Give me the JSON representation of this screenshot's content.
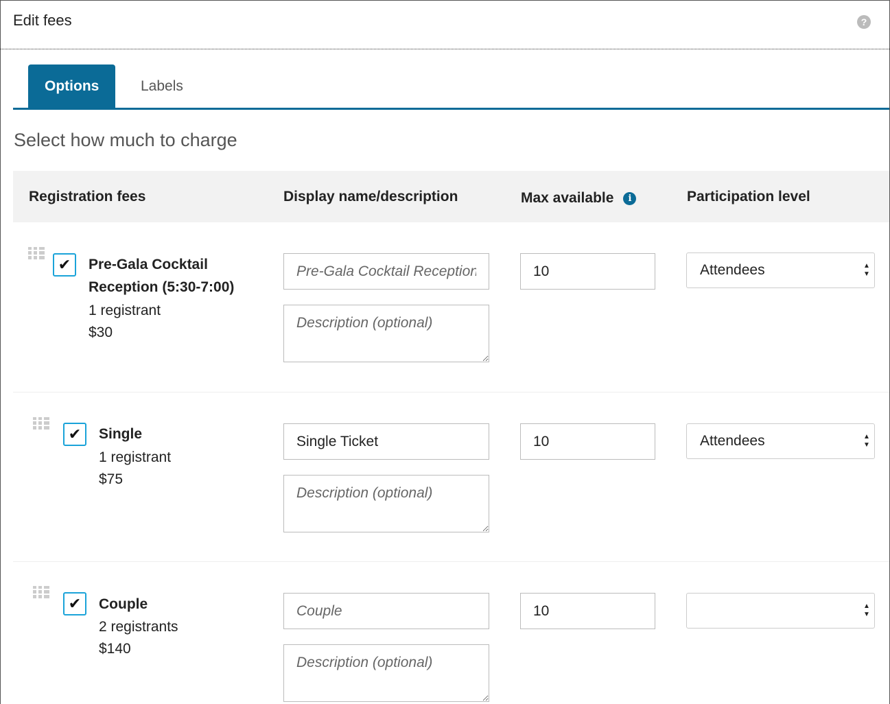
{
  "header": {
    "title": "Edit fees",
    "help_icon": "question-circle-icon"
  },
  "tabs": [
    {
      "label": "Options",
      "active": true
    },
    {
      "label": "Labels",
      "active": false
    }
  ],
  "section_title": "Select how much to charge",
  "table": {
    "columns": {
      "fees": "Registration fees",
      "display": "Display name/description",
      "max": "Max available",
      "level": "Participation level"
    },
    "rows": [
      {
        "checked": true,
        "name_line1": "Pre-Gala Cocktail",
        "name_line2": "Reception (5:30-7:00)",
        "registrants": "1 registrant",
        "price": "$30",
        "display_name_value": "",
        "display_name_placeholder": "Pre-Gala Cocktail Reception",
        "description_placeholder": "Description (optional)",
        "max_available": "10",
        "participation_level": "Attendees"
      },
      {
        "checked": true,
        "name_line1": "Single",
        "registrants": "1 registrant",
        "price": "$75",
        "display_name_value": "Single Ticket",
        "display_name_placeholder": "",
        "description_placeholder": "Description (optional)",
        "max_available": "10",
        "participation_level": "Attendees"
      },
      {
        "checked": true,
        "name_line1": "Couple",
        "registrants": "2 registrants",
        "price": "$140",
        "display_name_value": "",
        "display_name_placeholder": "Couple",
        "description_placeholder": "Description (optional)",
        "max_available": "10",
        "participation_level": ""
      }
    ]
  },
  "colors": {
    "accent": "#0b6b97",
    "checkbox_border": "#1aa3d9"
  },
  "glyphs": {
    "check": "✔",
    "help": "?",
    "info": "i",
    "arrow_up": "▲",
    "arrow_down": "▼"
  }
}
